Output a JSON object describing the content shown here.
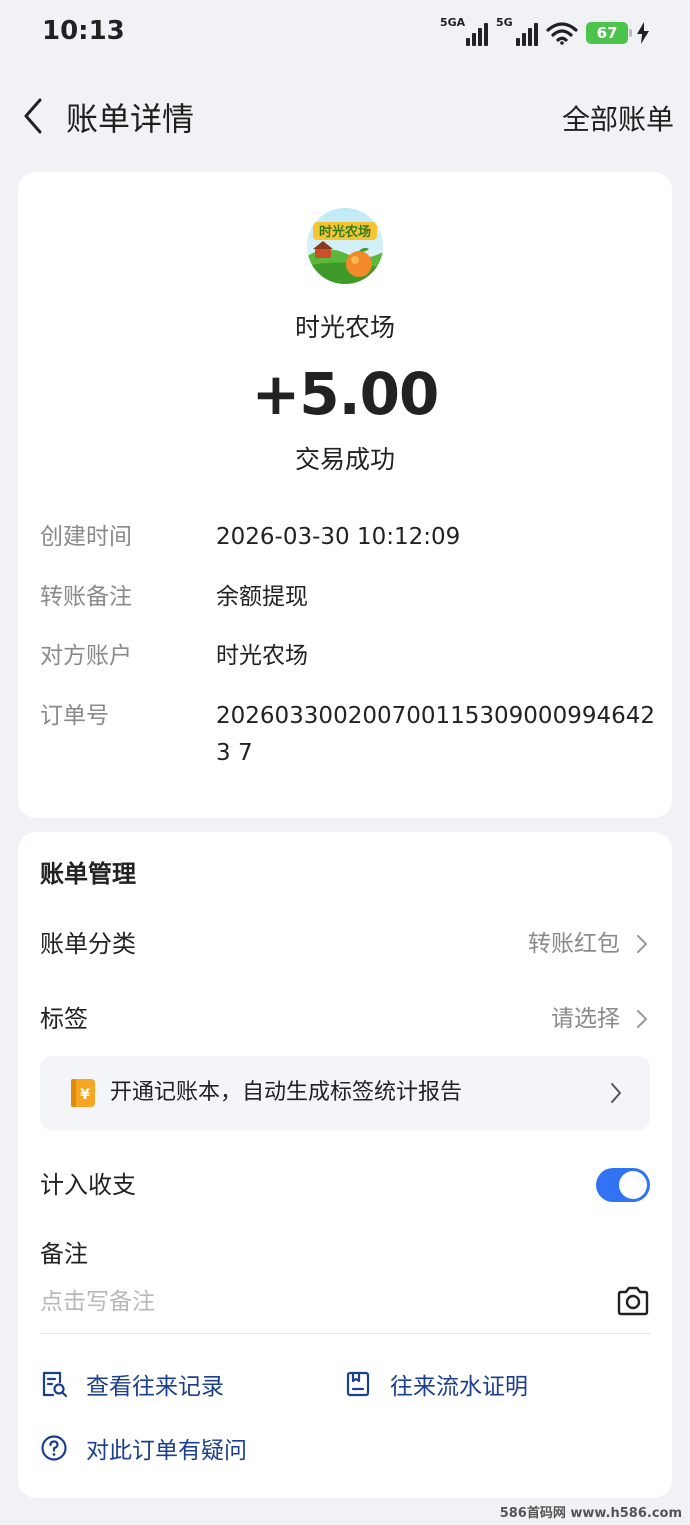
{
  "status_bar": {
    "time": "10:13",
    "signal1_label": "5GA",
    "signal2_label": "5G",
    "battery": "67"
  },
  "nav": {
    "title": "账单详情",
    "right_link": "全部账单"
  },
  "bill": {
    "merchant_name": "时光农场",
    "amount": "+5.00",
    "status": "交易成功",
    "details": [
      {
        "label": "创建时间",
        "value": "2026-03-30 10:12:09"
      },
      {
        "label": "转账备注",
        "value": "余额提现"
      },
      {
        "label": "对方账户",
        "value": "时光农场"
      },
      {
        "label": "订单号",
        "value": "2026033002007001153090009946423 7"
      }
    ]
  },
  "management": {
    "title": "账单管理",
    "category_label": "账单分类",
    "category_value": "转账红包",
    "tag_label": "标签",
    "tag_value": "请选择",
    "promo_text": "开通记账本，自动生成标签统计报告",
    "include_label": "计入收支",
    "include_enabled": true,
    "note_label": "备注",
    "note_placeholder": "点击写备注",
    "link_records": "查看往来记录",
    "link_proof": "往来流水证明",
    "link_question": "对此订单有疑问"
  },
  "colors": {
    "accent_blue": "#3273f4",
    "link_blue": "#1c3f8f",
    "page_bg": "#f1f2f5",
    "battery_green": "#4cc34b",
    "promo_icon": "#f5a623"
  },
  "watermark": "586首码网 www.h586.com"
}
